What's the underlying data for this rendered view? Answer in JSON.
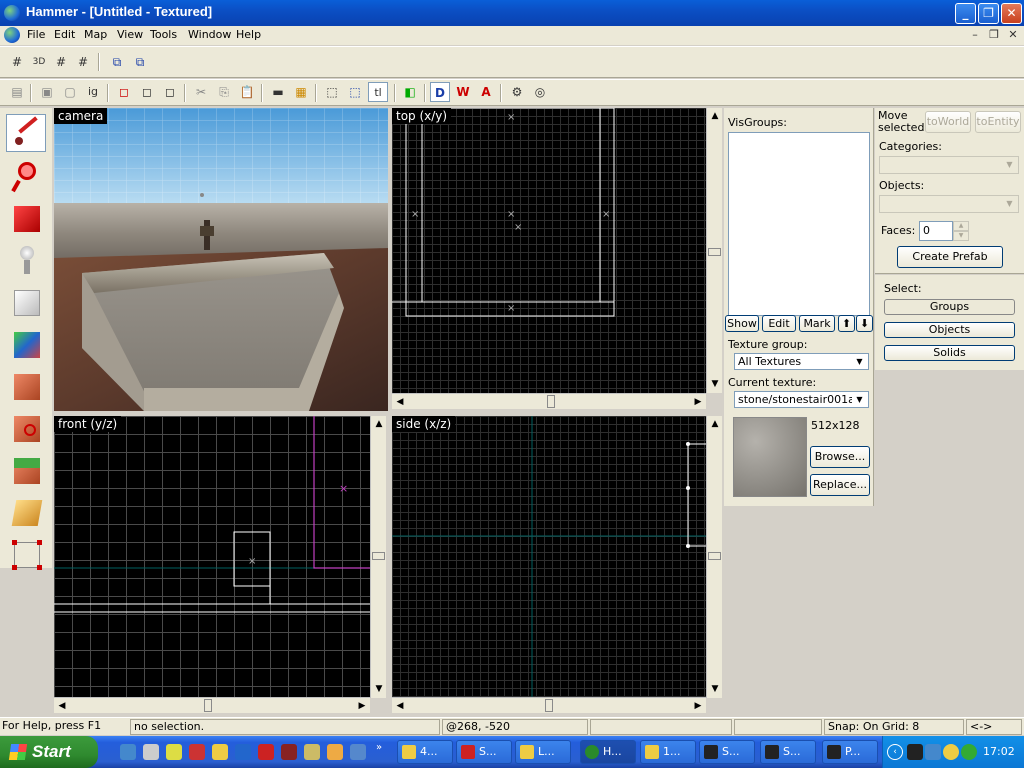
{
  "window": {
    "title": "Hammer - [Untitled - Textured]"
  },
  "menu": [
    "File",
    "Edit",
    "Map",
    "View",
    "Tools",
    "Window",
    "Help"
  ],
  "toolbar_text": {
    "t3d": "3D",
    "tl": "tl",
    "ig": "ig"
  },
  "viewports": {
    "camera": "camera",
    "top": "top (x/y)",
    "front": "front (y/z)",
    "side": "side (x/z)"
  },
  "visgroups": {
    "label": "VisGroups:",
    "show": "Show",
    "edit": "Edit",
    "mark": "Mark"
  },
  "texture": {
    "group_label": "Texture group:",
    "group_value": "All Textures",
    "current_label": "Current texture:",
    "current_value": "stone/stonestair001a",
    "size": "512x128",
    "browse": "Browse...",
    "replace": "Replace..."
  },
  "move": {
    "label": "Move selected:",
    "to_world": "toWorld",
    "to_entity": "toEntity",
    "categories_label": "Categories:",
    "objects_label": "Objects:",
    "faces_label": "Faces:",
    "faces_value": "0",
    "create_prefab": "Create Prefab"
  },
  "select": {
    "label": "Select:",
    "groups": "Groups",
    "objects": "Objects",
    "solids": "Solids"
  },
  "status": {
    "help": "For Help, press F1",
    "selection": "no selection.",
    "coords": "@268, -520",
    "snap": "Snap: On Grid: 8",
    "arrows": "<->"
  },
  "taskbar": {
    "start": "Start",
    "tasks": [
      "4...",
      "S...",
      "L...",
      "H...",
      "1...",
      "S...",
      "S...",
      "P..."
    ],
    "clock": "17:02"
  },
  "colors": {
    "titlebar": "#0b4fc4",
    "grid": "#2e2e2e",
    "brush": "#ffffff",
    "selection_magenta": "#c040c0",
    "axis_teal": "#006060"
  }
}
